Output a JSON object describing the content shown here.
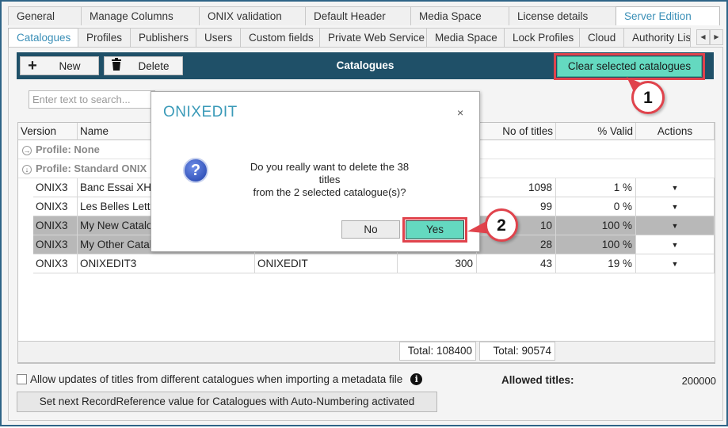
{
  "tabs_row1": [
    "General",
    "Manage Columns",
    "ONIX validation",
    "Default Header",
    "Media Space",
    "License details",
    "Server Edition"
  ],
  "tabs_row2": [
    "Catalogues",
    "Profiles",
    "Publishers",
    "Users",
    "Custom fields",
    "Private Web Service",
    "Media Space",
    "Lock Profiles",
    "Cloud",
    "Authority List"
  ],
  "toolbar": {
    "new_label": "New",
    "delete_label": "Delete",
    "title": "Catalogues",
    "clear_label": "Clear selected catalogues"
  },
  "search": {
    "placeholder": "Enter text to search..."
  },
  "grid": {
    "columns": [
      "Version",
      "Name",
      "",
      "",
      "No of titles",
      "% Valid",
      "Actions"
    ],
    "profiles": [
      "Profile: None",
      "Profile: Standard ONIX"
    ],
    "rows": [
      {
        "version": "ONIX3",
        "name": "Banc Essai XHT",
        "publisher": "",
        "allowed": "",
        "titles": "1098",
        "valid": "1 %",
        "selected": false
      },
      {
        "version": "ONIX3",
        "name": "Les Belles Lettr",
        "publisher": "",
        "allowed": "",
        "titles": "99",
        "valid": "0 %",
        "selected": false
      },
      {
        "version": "ONIX3",
        "name": "My New Catalo",
        "publisher": "",
        "allowed": "",
        "titles": "10",
        "valid": "100 %",
        "selected": true
      },
      {
        "version": "ONIX3",
        "name": "My Other Catal",
        "publisher": "",
        "allowed": "",
        "titles": "28",
        "valid": "100 %",
        "selected": true
      },
      {
        "version": "ONIX3",
        "name": "ONIXEDIT3",
        "publisher": "ONIXEDIT",
        "allowed": "300",
        "titles": "43",
        "valid": "19 %",
        "selected": false
      }
    ],
    "total_allowed": "Total:  108400",
    "total_titles": "Total:  90574"
  },
  "footer": {
    "allow_updates_label": "Allow updates of titles from different catalogues when importing a metadata file",
    "allowed_titles_label": "Allowed titles:",
    "allowed_titles_value": "200000",
    "record_ref_button": "Set next RecordReference value for Catalogues with Auto-Numbering activated"
  },
  "dialog": {
    "title": "ONIXEDIT",
    "close": "×",
    "message_line1": "Do you really want to delete the 38 titles",
    "message_line2": "from the 2 selected catalogue(s)?",
    "no_label": "No",
    "yes_label": "Yes"
  },
  "callouts": [
    "1",
    "2"
  ],
  "icons": {
    "new": "plus-icon",
    "delete": "trash-icon",
    "question": "question-icon",
    "info": "info-icon"
  },
  "colors": {
    "toolbar": "#1f5068",
    "accent": "#64d9c0",
    "callout": "#e0434c",
    "tab_active": "#3a8fb7"
  }
}
